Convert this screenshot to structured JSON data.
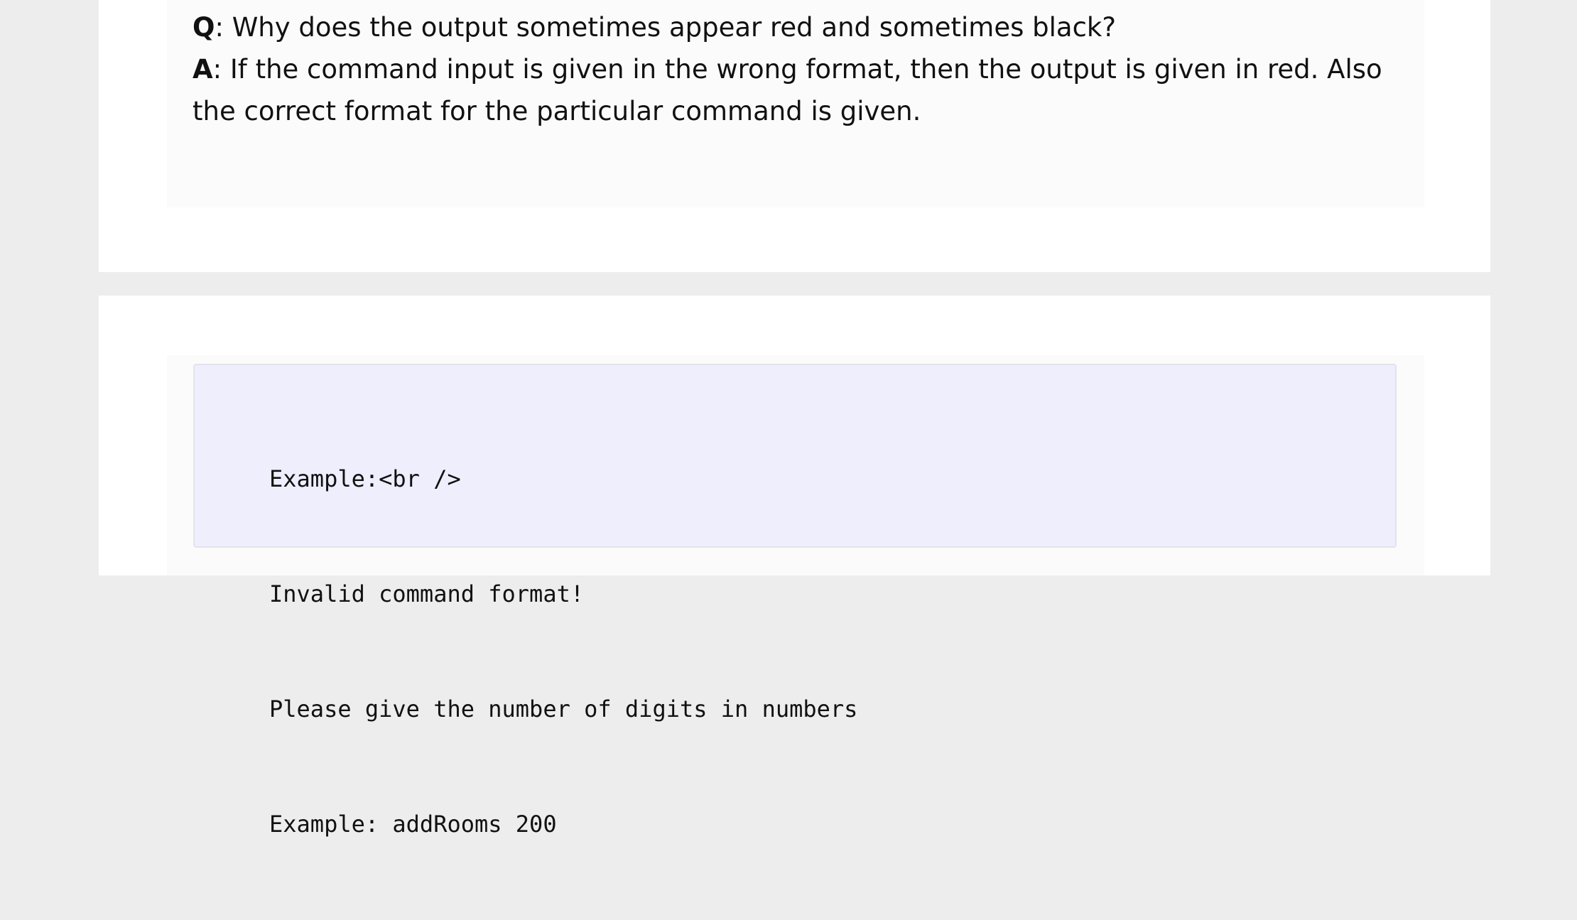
{
  "faq": {
    "question_label": "Q",
    "question_text": ": Why does the output sometimes appear red and sometimes black?",
    "answer_label": "A",
    "answer_text": ": If the command input is given in the wrong format, then the output is given in red. Also the correct format for the particular command is given."
  },
  "code_block": {
    "lines": [
      "Example:<br />",
      "Invalid command format!",
      "Please give the number of digits in numbers",
      "Example: addRooms 200"
    ]
  }
}
